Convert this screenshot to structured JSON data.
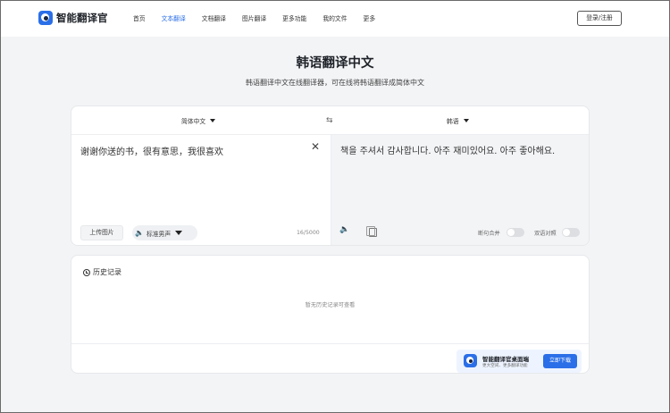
{
  "brand": {
    "name": "智能翻译官"
  },
  "nav": {
    "items": [
      "首页",
      "文本翻译",
      "文档翻译",
      "图片翻译",
      "更多功能",
      "我的文件",
      "更多"
    ],
    "active_index": 1,
    "login_label": "登录/注册"
  },
  "page": {
    "title": "韩语翻译中文",
    "subtitle": "韩语翻译中文在线翻译器，可在线将韩语翻译成简体中文"
  },
  "translator": {
    "source_lang": "简体中文",
    "target_lang": "韩语",
    "source_text": "谢谢你送的书，很有意思，我很喜欢",
    "target_text": "책을 주셔서 감사합니다. 아주 재미있어요. 아주 좋아해요.",
    "upload_label": "上传图片",
    "voice_label": "标准男声",
    "char_count": "16/5000",
    "option_merge": "断句合并",
    "option_bilingual": "双语对照",
    "toggle_merge_on": false,
    "toggle_bilingual_on": false
  },
  "history": {
    "title": "历史记录",
    "empty_text": "暂无历史记录可查看",
    "promo_title": "智能翻译官桌面端",
    "promo_sub": "更大空间、更多翻译功能",
    "download_label": "立即下载"
  },
  "colors": {
    "accent": "#2b6fe8",
    "background": "#f3f4f6"
  }
}
